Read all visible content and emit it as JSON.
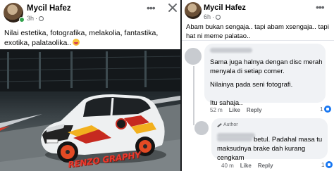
{
  "left_post": {
    "author": "Mycil Hafez",
    "time": "3h",
    "caption": "Nilai estetika, fotografika, melakolia, fantastika, exotika, palataolika..",
    "more_icon": "more-horizontal-icon",
    "close_icon": "close-icon",
    "watermark": "RENZO GRAPHY"
  },
  "right_post": {
    "author": "Mycil Hafez",
    "time": "6h",
    "caption": "Abam bukan sengaja.. tapi abam xsengaja.. tapi hat ni meme palatao..",
    "comments": [
      {
        "lines": [
          "Sama juga halnya dengan disc merah menyala di setiap corner."
        ],
        "extra": "Nilainya pada seni fotografi.",
        "extra2": "Itu sahaja..",
        "time": "52 m",
        "like": "Like",
        "reply": "Reply",
        "reactions": "1"
      },
      {
        "badge": "Author",
        "text": "betul. Padahal masa tu maksudnya brake dah kurang cengkam",
        "time": "40 m",
        "like": "Like",
        "reply": "Reply",
        "reactions": "1"
      }
    ]
  },
  "colors": {
    "accent_blue": "#1877f2",
    "text_primary": "#050505",
    "text_secondary": "#65676b",
    "bubble": "#f0f2f5",
    "car_red": "#e8392d"
  }
}
